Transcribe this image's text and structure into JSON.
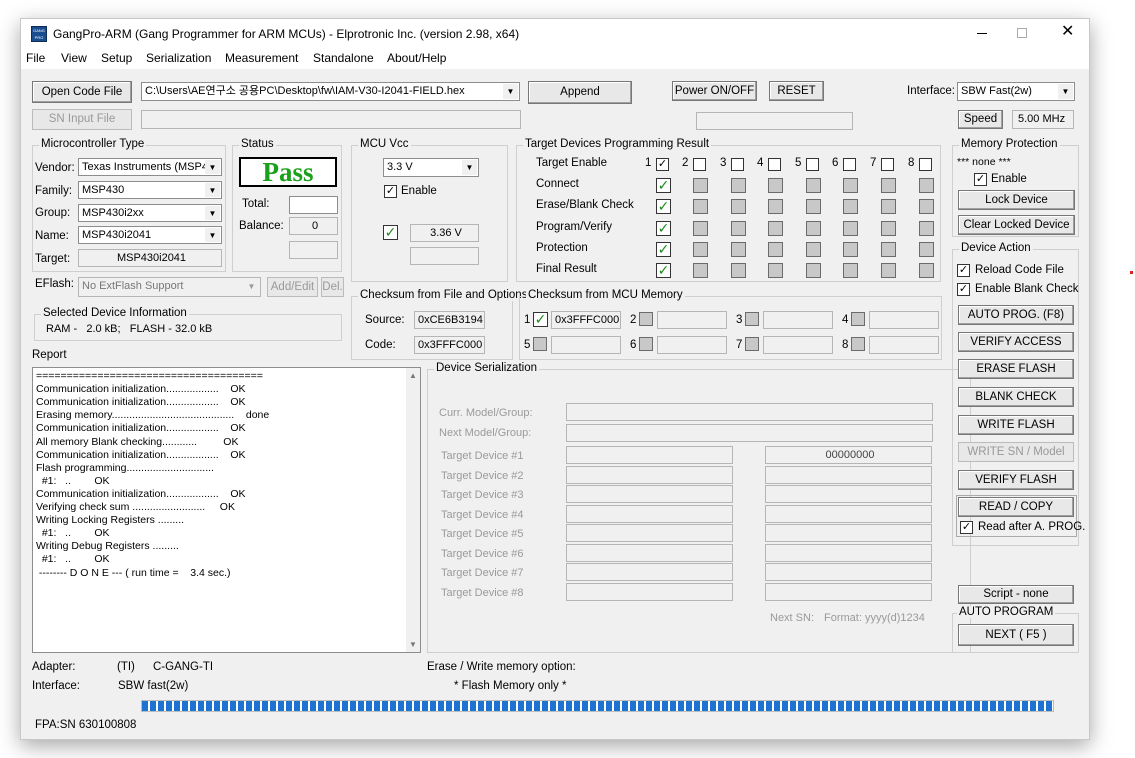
{
  "window": {
    "title": "GangPro-ARM (Gang Programmer for ARM MCUs) - Elprotronic Inc. (version 2.98, x64)",
    "app_icon_text": "GANG PRO"
  },
  "menu": [
    "File",
    "View",
    "Setup",
    "Serialization",
    "Measurement",
    "Standalone",
    "About/Help"
  ],
  "toolbar": {
    "open_code_file": "Open Code File",
    "code_file_path": "C:\\Users\\AE연구소 공용PC\\Desktop\\fw\\IAM-V30-I2041-FIELD.hex",
    "append": "Append",
    "power": "Power ON/OFF",
    "reset": "RESET",
    "interface_label": "Interface:",
    "interface_value": "SBW Fast(2w)",
    "speed_button": "Speed",
    "speed_value": "5.00 MHz",
    "sn_input_file": "SN Input File"
  },
  "mcu_type": {
    "title": "Microcontroller Type",
    "vendor_label": "Vendor:",
    "vendor": "Texas Instruments (MSP4",
    "family_label": "Family:",
    "family": "MSP430",
    "group_label": "Group:",
    "group": "MSP430i2xx",
    "name_label": "Name:",
    "name": "MSP430i2041",
    "target_label": "Target:",
    "target": "MSP430i2041"
  },
  "eflash": {
    "label": "EFlash:",
    "value": "No ExtFlash Support",
    "add_edit": "Add/Edit",
    "del": "Del."
  },
  "status": {
    "title": "Status",
    "result": "Pass",
    "total_label": "Total:",
    "total": "",
    "balance_label": "Balance:",
    "balance": "0"
  },
  "mcu_vcc": {
    "title": "MCU Vcc",
    "value": "3.3 V",
    "enable": "Enable",
    "measured": "3.36 V"
  },
  "target_result": {
    "title": "Target Devices Programming Result",
    "target_enable": "Target Enable",
    "device_numbers": [
      "1",
      "2",
      "3",
      "4",
      "5",
      "6",
      "7",
      "8"
    ],
    "rows": [
      "Connect",
      "Erase/Blank Check",
      "Program/Verify",
      "Protection",
      "Final Result"
    ]
  },
  "memory_protection": {
    "title": "Memory Protection",
    "status": "*** none ***",
    "enable": "Enable",
    "lock_device": "Lock Device",
    "clear_locked": "Clear Locked Device"
  },
  "checksum_file": {
    "title": "Checksum from File and Options",
    "source_label": "Source:",
    "source": "0xCE6B3194",
    "code_label": "Code:",
    "code": "0x3FFFC000"
  },
  "checksum_mcu": {
    "title": "Checksum from MCU Memory",
    "slots": [
      {
        "n": "1",
        "value": "0x3FFFC000"
      },
      {
        "n": "2",
        "value": ""
      },
      {
        "n": "3",
        "value": ""
      },
      {
        "n": "4",
        "value": ""
      },
      {
        "n": "5",
        "value": ""
      },
      {
        "n": "6",
        "value": ""
      },
      {
        "n": "7",
        "value": ""
      },
      {
        "n": "8",
        "value": ""
      }
    ]
  },
  "selected_device": {
    "title": "Selected Device Information",
    "info": "RAM -   2.0 kB;   FLASH - 32.0 kB"
  },
  "report": {
    "label": "Report",
    "lines": [
      "=====================================",
      "Communication initialization..................    OK",
      "Communication initialization..................    OK",
      "Erasing memory..........................................    done",
      "Communication initialization..................    OK",
      "All memory Blank checking............         OK",
      "Communication initialization..................    OK",
      "Flash programming..............................",
      "  #1:   ..        OK",
      "Communication initialization..................    OK",
      "Verifying check sum .........................     OK",
      "Writing Locking Registers .........",
      "  #1:   ..        OK",
      "Writing Debug Registers .........",
      "  #1:   ..        OK",
      " -------- D O N E --- ( run time =    3.4 sec.)"
    ]
  },
  "serialization": {
    "title": "Device Serialization",
    "curr_model": "Curr. Model/Group:",
    "next_model": "Next Model/Group:",
    "targets": [
      "Target Device #1",
      "Target Device #2",
      "Target Device #3",
      "Target Device #4",
      "Target Device #5",
      "Target Device #6",
      "Target Device #7",
      "Target Device #8"
    ],
    "sn1": "00000000",
    "next_sn": "Next SN:",
    "format": "Format: yyyy(d)1234"
  },
  "device_action": {
    "title": "Device Action",
    "reload": "Reload Code File",
    "blank_check": "Enable Blank Check",
    "auto_prog": "AUTO PROG. (F8)",
    "verify_access": "VERIFY ACCESS",
    "erase_flash": "ERASE FLASH",
    "blank_check_btn": "BLANK CHECK",
    "write_flash": "WRITE FLASH",
    "write_sn": "WRITE SN / Model",
    "verify_flash": "VERIFY FLASH",
    "read_copy": "READ / COPY",
    "read_after": "Read after A. PROG."
  },
  "auto_program": {
    "script": "Script - none",
    "title": "AUTO PROGRAM",
    "next": "NEXT  ( F5 )"
  },
  "footer": {
    "adapter_label": "Adapter:",
    "adapter_ti": "(TI)",
    "adapter": "C-GANG-TI",
    "interface_label": "Interface:",
    "interface": "SBW fast(2w)",
    "erase_option_label": "Erase / Write memory option:",
    "erase_option": "* Flash Memory only *",
    "progress": 1.0,
    "fpa_sn": "FPA:SN 630100808"
  },
  "colors": {
    "pass": "#1aa01a",
    "check_green": "#1a8a1a",
    "progress": "#1e73d2"
  }
}
